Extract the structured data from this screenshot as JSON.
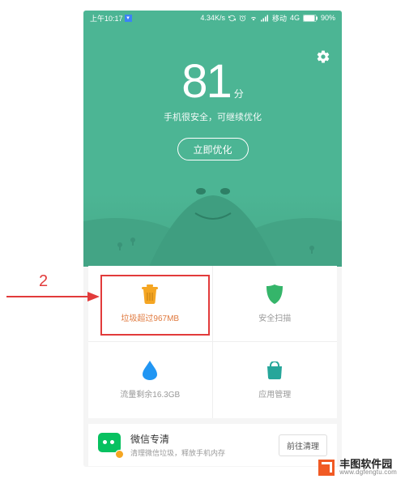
{
  "status": {
    "time": "上午10:17",
    "speed": "4.34K/s",
    "carrier": "移动",
    "net": "4G",
    "battery": "90%"
  },
  "hero": {
    "score": "81",
    "unit": "分",
    "subtitle": "手机很安全，可继续优化",
    "button": "立即优化"
  },
  "tiles": [
    {
      "key": "trash",
      "label": "垃圾超过967MB",
      "icon": "trash-icon",
      "warn": true
    },
    {
      "key": "scan",
      "label": "安全扫描",
      "icon": "shield-icon",
      "warn": false
    },
    {
      "key": "data",
      "label": "流量剩余16.3GB",
      "icon": "drop-icon",
      "warn": false
    },
    {
      "key": "apps",
      "label": "应用管理",
      "icon": "bag-icon",
      "warn": false
    }
  ],
  "promo": {
    "title": "微信专清",
    "subtitle": "清理微信垃圾，释放手机内存",
    "button": "前往清理"
  },
  "colors": {
    "primary": "#4cb594",
    "warn": "#e07a3f",
    "annotate": "#e23b3b"
  },
  "annotation": {
    "number": "2"
  },
  "watermark": {
    "title": "丰图软件园",
    "url": "www.dgfengtu.com"
  }
}
